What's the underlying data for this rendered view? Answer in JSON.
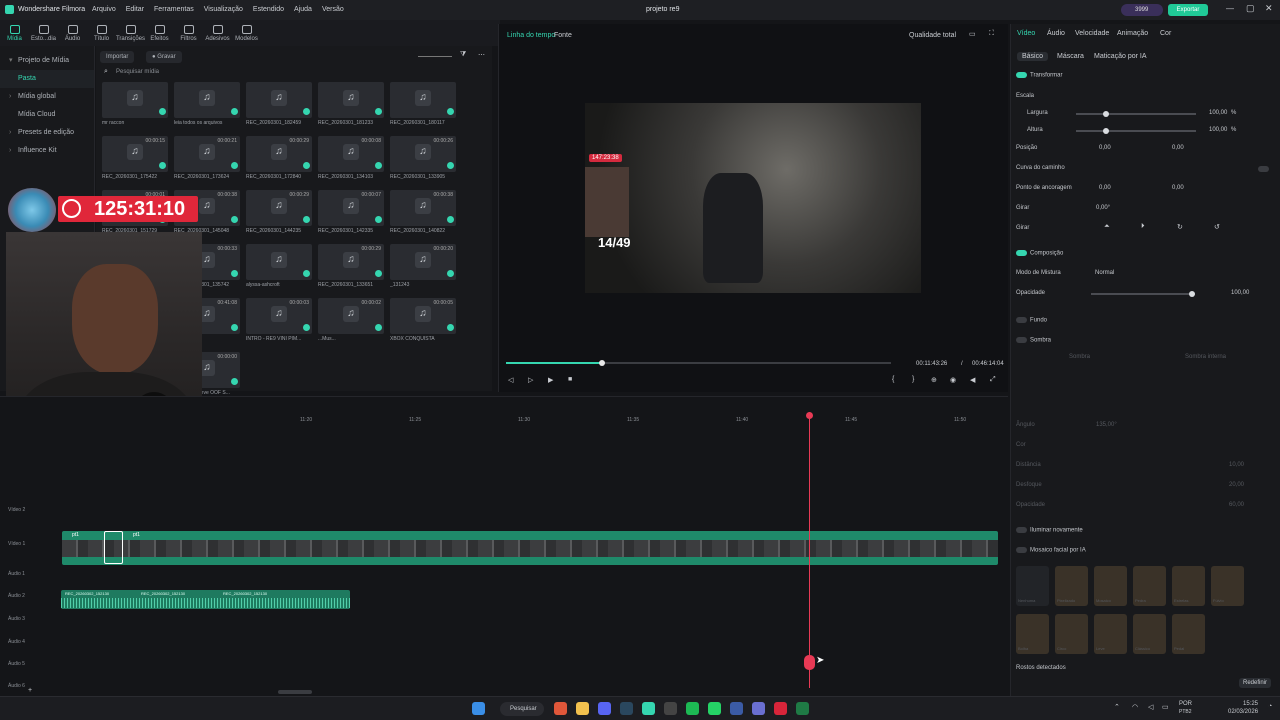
{
  "titlebar": {
    "app_name": "Wondershare Filmora",
    "menu": [
      "Arquivo",
      "Editar",
      "Ferramentas",
      "Visualização",
      "Estendido",
      "Ajuda",
      "Versão"
    ],
    "project_title": "projeto re9",
    "credits": "3999",
    "export_label": "Exportar"
  },
  "toolbar": {
    "items": [
      "Mídia",
      "Esto...dia",
      "Áudio",
      "Título",
      "Transições",
      "Efeitos",
      "Filtros",
      "Adesivos",
      "Modelos"
    ]
  },
  "sidebar": {
    "items": [
      "Projeto de Mídia",
      "Pasta",
      "Mídia global",
      "Mídia Cloud",
      "Presets de edição",
      "Influence Kit"
    ]
  },
  "media": {
    "import_label": "Importar",
    "record_label": "Gravar",
    "search_placeholder": "Pesquisar mídia",
    "files": [
      {
        "name": "mr raccon",
        "dur": ""
      },
      {
        "name": "leia todos os arquivos",
        "dur": ""
      },
      {
        "name": "REC_20260301_182459",
        "dur": ""
      },
      {
        "name": "REC_20260301_181233",
        "dur": ""
      },
      {
        "name": "REC_20260301_180117",
        "dur": ""
      },
      {
        "name": "REC_20260301_175422",
        "dur": "00:00:15"
      },
      {
        "name": "REC_20260301_173624",
        "dur": "00:00:21"
      },
      {
        "name": "REC_20260301_172840",
        "dur": "00:00:29"
      },
      {
        "name": "REC_20260301_134103",
        "dur": "00:00:08"
      },
      {
        "name": "REC_20260301_133905",
        "dur": "00:00:26"
      },
      {
        "name": "REC_20260301_151729",
        "dur": "00:00:01"
      },
      {
        "name": "REC_20260301_145048",
        "dur": "00:00:38"
      },
      {
        "name": "REC_20260301_144235",
        "dur": "00:00:29"
      },
      {
        "name": "REC_20260301_142335",
        "dur": "00:00:07"
      },
      {
        "name": "REC_20260301_140822",
        "dur": "00:00:38"
      },
      {
        "name": "l_Outbre...",
        "dur": "00:00:22"
      },
      {
        "name": "REC_20260301_135742",
        "dur": "00:00:33"
      },
      {
        "name": "alyssa-ashcroft",
        "dur": ""
      },
      {
        "name": "REC_20260301_133651",
        "dur": "00:00:29"
      },
      {
        "name": "_131243",
        "dur": "00:00:20"
      },
      {
        "name": "REC_20260301_131142",
        "dur": "00:00:23"
      },
      {
        "name": "pt1",
        "dur": "00:41:08"
      },
      {
        "name": "INTRO - RE9 VINI PIM...",
        "dur": "00:00:03"
      },
      {
        "name": "...Mus...",
        "dur": "00:00:02"
      },
      {
        "name": "XBOX CONQUISTA",
        "dur": "00:00:05"
      },
      {
        "name": "Yoshi Sound Ba Dum",
        "dur": "00:00:03"
      },
      {
        "name": "Minecraft Steve OOF S...",
        "dur": "00:00:00"
      }
    ]
  },
  "overlay": {
    "timer": "125:31:10",
    "mini_timer": "147:23:38",
    "counter": "14/49"
  },
  "preview": {
    "tabs": [
      "Linha do tempo",
      "Fonte"
    ],
    "quality": "Qualidade total",
    "current_time": "00:11:43:26",
    "separator": "/",
    "total_time": "00:46:14:04",
    "progress": 0.25
  },
  "props": {
    "tabs": [
      "Vídeo",
      "Áudio",
      "Velocidade",
      "Animação",
      "Cor"
    ],
    "subtabs": [
      "Básico",
      "Máscara",
      "Maticação por IA"
    ],
    "transform_label": "Transformar",
    "scale_label": "Escala",
    "width_label": "Largura",
    "width_val": "100,00",
    "height_label": "Altura",
    "height_val": "100,00",
    "unit_pct": "%",
    "position_label": "Posição",
    "pos_x": "0,00",
    "pos_y": "0,00",
    "path_label": "Curva do caminho",
    "anchor_label": "Ponto de ancoragem",
    "anchor_x": "0,00",
    "anchor_y": "0,00",
    "rotate_label": "Girar",
    "rotate_val": "0,00°",
    "flip_label": "Girar",
    "composition_label": "Composição",
    "blend_label": "Modo de Mistura",
    "blend_val": "Normal",
    "opacity_label": "Opacidade",
    "opacity_val": "100,00",
    "bg_label": "Fundo",
    "shadow_label": "Sombra",
    "shadow_tab1": "Sombra",
    "shadow_tab2": "Sombra interna",
    "angle_label": "Ângulo",
    "angle_val": "135,00°",
    "color_label": "Cor",
    "distance_label": "Distância",
    "distance_val": "10,00",
    "blur_label": "Desfoque",
    "blur_val": "20,00",
    "shadow_opacity_label": "Opacidade",
    "shadow_opacity_val": "60,00",
    "relight_label": "Iluminar novamente",
    "mosaic_label": "Mosaico facial por IA",
    "mosaic_options": [
      "Nenhuma",
      "Pixelizado",
      "Mosaico",
      "Pedra",
      "Estrelas",
      "Fúlvio",
      "Bolha",
      "Circo",
      "Leve",
      "Clássico",
      "Pedal"
    ],
    "faces_detected": "Rostos detectados",
    "reset_label": "Redefinir"
  },
  "timeline": {
    "ruler": [
      "11:20",
      "11:25",
      "11:30",
      "11:35",
      "11:40",
      "11:45",
      "11:50"
    ],
    "tracks": [
      "Vídeo 2",
      "Vídeo 1",
      "Áudio 1",
      "Áudio 2",
      "Áudio 3",
      "Áudio 4",
      "Áudio 5",
      "Áudio 6"
    ],
    "clip_label": "pt1",
    "audio_clip_labels": [
      "REC_20260302_152130",
      "REC_20260302_152130",
      "REC_20260302_152130"
    ]
  },
  "taskbar": {
    "search_label": "Pesquisar",
    "lang": "POR",
    "lang_sub": "PTB2",
    "time": "15:25",
    "date": "02/03/2026"
  },
  "colors": {
    "accent": "#35d6b0",
    "playhead": "#e83a55",
    "timer_bg": "#e0273a",
    "export_btn": "#20c997"
  }
}
